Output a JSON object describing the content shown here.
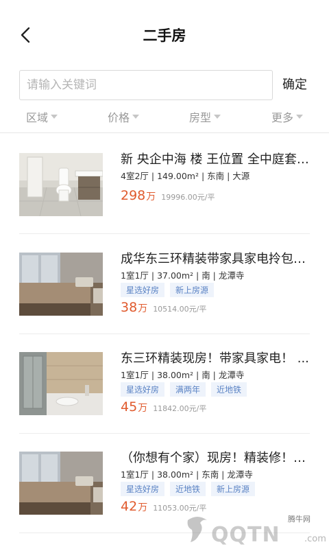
{
  "header": {
    "title": "二手房"
  },
  "search": {
    "placeholder": "请输入关键词",
    "value": "",
    "confirm_label": "确定"
  },
  "filters": [
    {
      "label": "区域"
    },
    {
      "label": "价格"
    },
    {
      "label": "房型"
    },
    {
      "label": "更多"
    }
  ],
  "listings": [
    {
      "title": "新 央企中海 楼 王位置 全中庭套三 ...",
      "meta": "4室2厅 | 149.00m² | 东南 | 大源",
      "tags": [],
      "price": "298",
      "price_unit": "万",
      "unit_price": "19996.00元/平"
    },
    {
      "title": "成华东三环精装带家具家电拎包入住",
      "meta": "1室1厅 | 37.00m² | 南 | 龙潭寺",
      "tags": [
        "星选好房",
        "新上房源"
      ],
      "price": "38",
      "price_unit": "万",
      "unit_price": "10514.00元/平"
    },
    {
      "title": "东三环精装现房！带家具家电！ ...",
      "meta": "1室1厅 | 38.00m² | 南 | 龙潭寺",
      "tags": [
        "星选好房",
        "满两年",
        "近地铁"
      ],
      "price": "45",
      "price_unit": "万",
      "unit_price": "11842.00元/平"
    },
    {
      "title": "（你想有个家）现房！精装修！送家具...",
      "meta": "1室1厅 | 38.00m² | 东南 | 龙潭寺",
      "tags": [
        "星选好房",
        "近地铁",
        "新上房源"
      ],
      "price": "42",
      "price_unit": "万",
      "unit_price": "11053.00元/平"
    }
  ],
  "watermark": {
    "small": "腾牛网",
    "big": "QQTN",
    "suffix": ".com"
  },
  "colors": {
    "price": "#e05a2d",
    "tag_text": "#5b83c4",
    "tag_bg": "#eef3fb"
  }
}
